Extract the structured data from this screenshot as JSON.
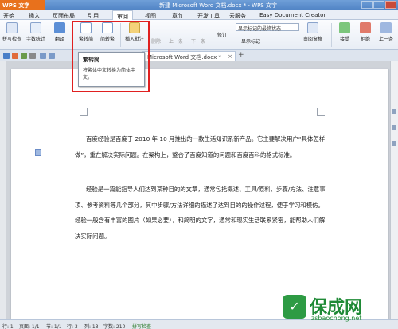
{
  "window": {
    "app_button": "WPS 文字",
    "title": "新建 Microsoft Word 文档.docx * - WPS 文字"
  },
  "menu": {
    "tabs": [
      "开始",
      "插入",
      "页面布局",
      "引用",
      "审阅",
      "视图",
      "章节",
      "开发工具",
      "云服务",
      "Easy Document Creator"
    ],
    "active": "审阅"
  },
  "ribbon": {
    "spell_check": "拼写检查",
    "word_count": "字数统计",
    "translate": "翻译",
    "to_traditional": "繁转简",
    "to_simplified": "简转繁",
    "insert_comment": "插入批注",
    "delete": "删除",
    "prev": "上一条",
    "next": "下一条",
    "show_final_markup": "显示标记的最终状态",
    "show_markup": "显示标记",
    "review_pane": "审阅窗格",
    "track_changes": "修订",
    "accept": "接受",
    "reject": "拒绝",
    "prev2": "上一条"
  },
  "doc_tab": {
    "label": "Microsoft Word 文档.docx *",
    "close": "×",
    "new_tab": "+"
  },
  "tooltip": {
    "title": "繁转简",
    "description": "将繁体中文转换为简体中文。"
  },
  "document": {
    "paragraphs": [
      "百度经验是百度于 2010 年 10 月推出的一款生活知识系新产品。它主要解决用户“具体怎样做”，重在解决实际问题。在架构上，整合了百度知道的问题和百度百科的格式标准。",
      "经验是一篇能指导人们达到某种目的的文章，通常包括概述、工具/原料、步骤/方法、注意事项、参考资料等几个部分，其中步骤/方法详细的描述了达到目的的操作过程，便于学习和模仿。经验一般含有丰富的图片（如果必要），和简明的文字，通常和现实生活联系紧密，能帮助人们解决实际问题。"
    ]
  },
  "status_bar": {
    "row": "行: 1",
    "page": "页面: 1/1",
    "section": "节: 1/1",
    "line": "行: 3",
    "col": "列: 13",
    "words": "字数: 210",
    "spell": "拼写检查"
  },
  "watermark": {
    "title": "保成网",
    "url": "zsbaochong.net"
  },
  "colors": {
    "accent": "#e8711c",
    "highlight": "#e02020",
    "watermark": "#1f8a36"
  }
}
